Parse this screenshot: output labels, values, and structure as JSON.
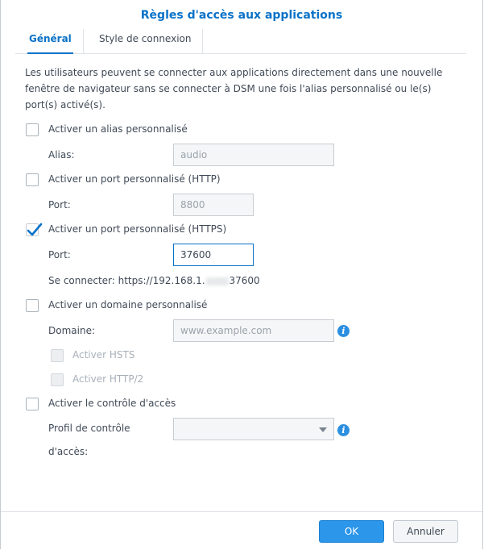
{
  "dialog": {
    "title": "Règles d'accès aux applications",
    "tabs": [
      {
        "label": "Général",
        "active": true
      },
      {
        "label": "Style de connexion",
        "active": false
      }
    ],
    "description": "Les utilisateurs peuvent se connecter aux applications directement dans une nouvelle fenêtre de navigateur sans se connecter à DSM une fois l'alias personnalisé ou le(s) port(s) activé(s).",
    "alias_section": {
      "checkbox_label": "Activer un alias personnalisé",
      "checked": false,
      "field_label": "Alias:",
      "field_value": "audio"
    },
    "http_section": {
      "checkbox_label": "Activer un port personnalisé (HTTP)",
      "checked": false,
      "field_label": "Port:",
      "field_value": "8800"
    },
    "https_section": {
      "checkbox_label": "Activer un port personnalisé (HTTPS)",
      "checked": true,
      "field_label": "Port:",
      "field_value": "37600",
      "connect_prefix": "Se connecter: https://192.168.1.",
      "connect_suffix": "37600"
    },
    "domain_section": {
      "checkbox_label": "Activer un domaine personnalisé",
      "checked": false,
      "field_label": "Domaine:",
      "field_placeholder": "www.example.com",
      "hsts_label": "Activer HSTS",
      "http2_label": "Activer HTTP/2"
    },
    "access_section": {
      "checkbox_label": "Activer le contrôle d'accès",
      "checked": false,
      "field_label_line1": "Profil de contrôle",
      "field_label_line2": "d'accès:",
      "select_value": ""
    },
    "footer": {
      "ok_label": "OK",
      "cancel_label": "Annuler"
    },
    "colors": {
      "accent": "#0a72c8",
      "primary_button": "#2c96ea",
      "text": "#404a57"
    }
  }
}
